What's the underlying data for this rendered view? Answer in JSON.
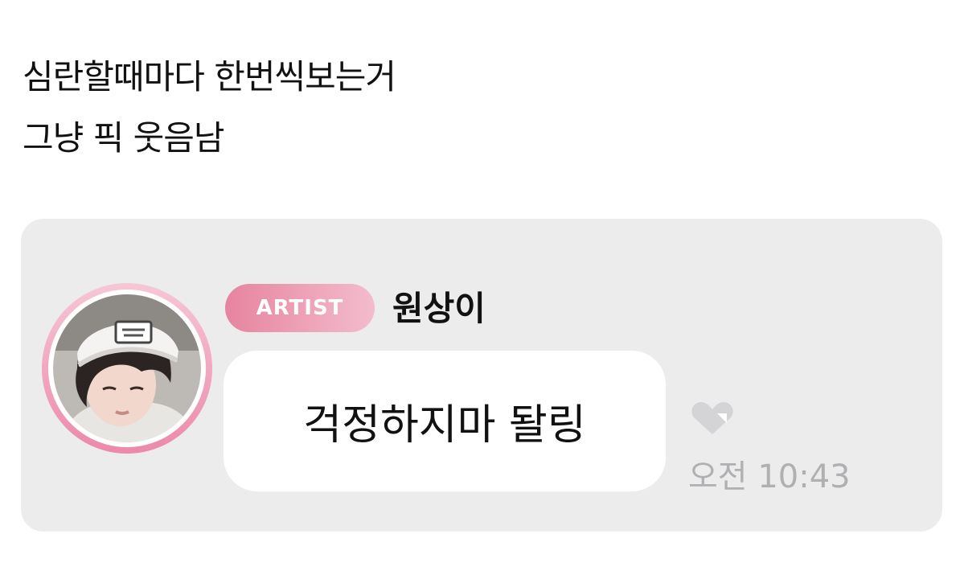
{
  "post": {
    "line1": "심란할때마다 한번씩보는거",
    "line2": "그냥 픽 웃음남"
  },
  "chat": {
    "badge_label": "ARTIST",
    "username": "원상이",
    "message": "걱정하지마 돨링",
    "timestamp": "오전 10:43",
    "icons": {
      "avatar": "profile-photo",
      "reaction": "heart-icon"
    },
    "colors": {
      "card_background": "#ececed",
      "badge_start": "#e7849f",
      "badge_end": "#f3bccd",
      "avatar_ring": "#ec89aa",
      "timestamp": "#b0b0b3"
    }
  }
}
